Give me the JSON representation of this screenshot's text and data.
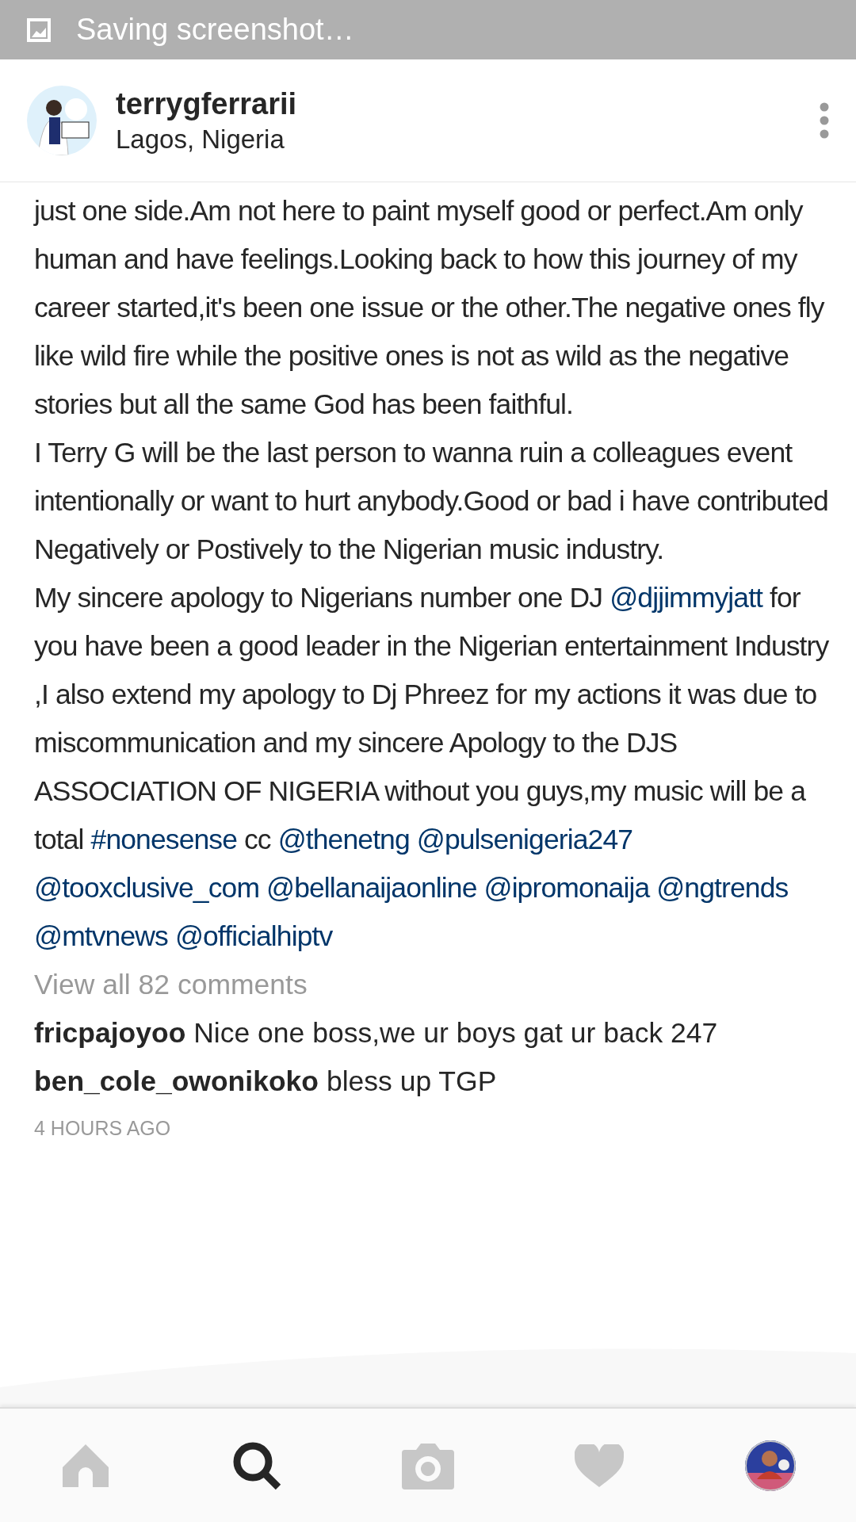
{
  "status_bar": {
    "notification": "Saving screenshot…"
  },
  "post_header": {
    "username": "terrygferrarii",
    "location": "Lagos, Nigeria"
  },
  "caption": {
    "paragraphs": [
      [
        {
          "kind": "text",
          "text": "just one side.Am not here to paint myself good or perfect.Am only human and have feelings.Looking back to how this journey of my career started,it's been one issue or the other.The negative ones fly like wild fire while the positive ones is not as wild as the negative stories but all the same God has been faithful."
        }
      ],
      [
        {
          "kind": "text",
          "text": "I Terry G will be the last person to wanna ruin a colleagues event intentionally or want to hurt anybody.Good or bad i have contributed Negatively or Postively to the Nigerian music industry."
        }
      ],
      [
        {
          "kind": "text",
          "text": "My sincere apology to Nigerians number one DJ "
        },
        {
          "kind": "link",
          "text": "@djjimmyjatt"
        },
        {
          "kind": "text",
          "text": " for you have been a good leader in the Nigerian entertainment Industry ,I also extend my apology to Dj Phreez for my actions it was due to miscommunication and my sincere Apology to the DJS ASSOCIATION OF NIGERIA without you guys,my music will be a total "
        },
        {
          "kind": "link",
          "text": "#nonesense"
        },
        {
          "kind": "text",
          "text": " cc "
        },
        {
          "kind": "link",
          "text": "@thenetng"
        },
        {
          "kind": "link",
          "text": "@pulsenigeria247"
        },
        {
          "kind": "link",
          "text": "@tooxclusive_com"
        },
        {
          "kind": "link",
          "text": "@bellanaijaonline"
        },
        {
          "kind": "link",
          "text": "@ipromonaija"
        },
        {
          "kind": "link",
          "text": "@ngtrends"
        },
        {
          "kind": "link",
          "text": "@mtvnews"
        },
        {
          "kind": "link",
          "text": "@officialhiptv"
        }
      ]
    ]
  },
  "view_comments": "View all 82 comments",
  "comments": [
    {
      "username": "fricpajoyoo",
      "text": "Nice one boss,we ur boys gat ur back 247"
    },
    {
      "username": "ben_cole_owonikoko",
      "text": "bless up TGP"
    }
  ],
  "timestamp": "4 HOURS AGO",
  "nav": [
    {
      "kind": "home",
      "selected": false
    },
    {
      "kind": "search",
      "selected": true
    },
    {
      "kind": "camera",
      "selected": false
    },
    {
      "kind": "activity",
      "selected": false
    },
    {
      "kind": "profile",
      "selected": false
    }
  ]
}
